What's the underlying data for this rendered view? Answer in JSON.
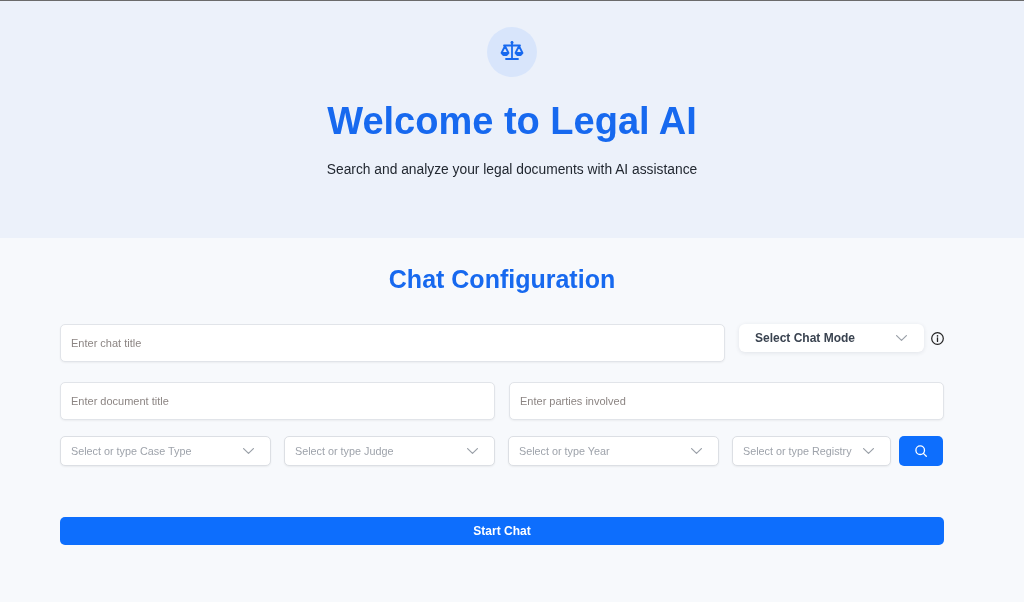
{
  "hero": {
    "title": "Welcome to Legal AI",
    "subtitle": "Search and analyze your legal documents with AI assistance"
  },
  "configuration": {
    "heading": "Chat Configuration",
    "chat_title": {
      "placeholder": "Enter chat title"
    },
    "chat_mode": {
      "label": "Select Chat Mode"
    },
    "document_title": {
      "placeholder": "Enter document title"
    },
    "parties": {
      "placeholder": "Enter parties involved"
    },
    "filters": [
      {
        "placeholder": "Select or type Case Type"
      },
      {
        "placeholder": "Select or type Judge"
      },
      {
        "placeholder": "Select or type Year"
      },
      {
        "placeholder": "Select or type Registry"
      }
    ],
    "start_button": {
      "label": "Start Chat"
    }
  }
}
